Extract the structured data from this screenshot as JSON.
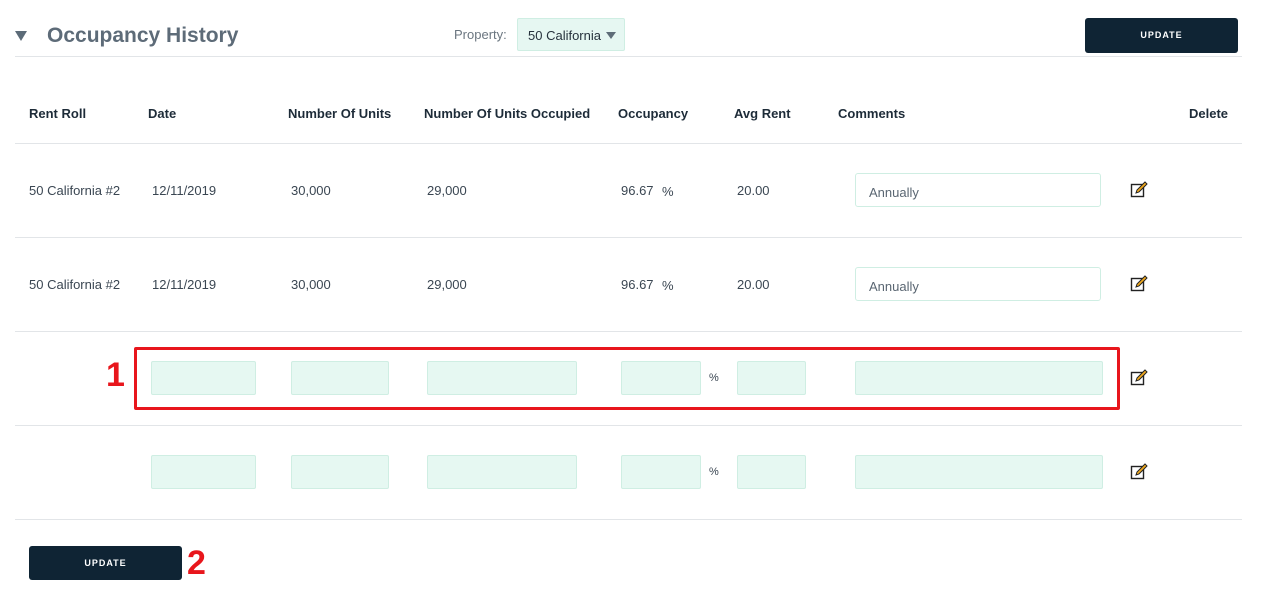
{
  "header": {
    "title": "Occupancy History",
    "property_label": "Property:",
    "property_value": "50 California",
    "update_label": "UPDATE"
  },
  "table": {
    "columns": [
      "Rent Roll",
      "Date",
      "Number Of Units",
      "Number Of Units Occupied",
      "Occupancy",
      "Avg Rent",
      "Comments",
      "Delete"
    ],
    "rows": [
      {
        "rent_roll": "50 California #2",
        "date": "12/11/2019",
        "units": "30,000",
        "occupied": "29,000",
        "occupancy": "96.67",
        "pct": "%",
        "avg_rent": "20.00",
        "comment": "Annually"
      },
      {
        "rent_roll": "50 California #2",
        "date": "12/11/2019",
        "units": "30,000",
        "occupied": "29,000",
        "occupancy": "96.67",
        "pct": "%",
        "avg_rent": "20.00",
        "comment": "Annually"
      }
    ],
    "new_rows": [
      {
        "pct": "%"
      },
      {
        "pct": "%"
      }
    ]
  },
  "footer": {
    "update_label": "UPDATE"
  },
  "annotations": {
    "marker_1": "1",
    "marker_2": "2"
  },
  "icons": {
    "collapse": "triangle-down-icon",
    "edit": "edit-pencil-icon",
    "dropdown": "caret-down-icon"
  },
  "colors": {
    "button_bg": "#0f2434",
    "field_bg": "#e6f8f2",
    "annotation_red": "#e8161c"
  }
}
